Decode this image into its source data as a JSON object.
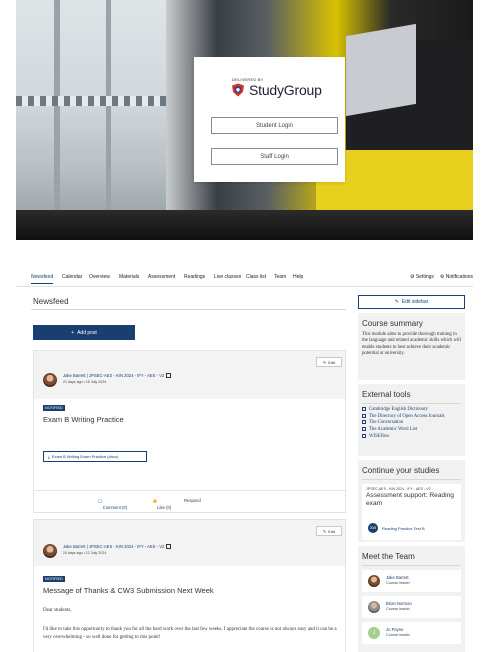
{
  "login": {
    "delivered_by": "DELIVERED BY",
    "brand": "StudyGroup",
    "student_login": "Student Login",
    "staff_login": "Staff Login"
  },
  "nav": {
    "tabs": [
      "Newsfeed",
      "Calendar",
      "Overview",
      "Materials",
      "Assessment",
      "Readings",
      "Live classes",
      "Class list",
      "Team",
      "Help"
    ],
    "settings": "Settings",
    "notifications": "Notifications"
  },
  "main": {
    "title": "Newsfeed",
    "add_post": "Add post",
    "posts": [
      {
        "edit": "Edit",
        "author": "Jake Barrett | JPSEC-AES - KIN 2024 - IFY - AES - V2",
        "meta": "21 days ago  •  15 July 2024",
        "badge": "NOTIFIED",
        "title": "Exam B Writing Practice",
        "attachment": "Exam B Writing Exam Practice (docx)",
        "comment": "Comment (0)",
        "like": "Like (0)",
        "respond": "Respond"
      },
      {
        "edit": "Edit",
        "author": "Jake Barrett | JPSEC-AES - KIN 2024 - IFY - AES - V2",
        "meta": "24 days ago  •  12 July 2024",
        "badge": "NOTIFIED",
        "title": "Message of Thanks & CW3 Submission Next Week",
        "greeting": "Dear students,",
        "body": "I'd like to take this opportunity to thank you for all the hard work over the last few weeks. I appreciate the course is not always easy and it can be a very overwhelming - so well done for getting to this point!"
      }
    ]
  },
  "sidebar": {
    "edit_sidebar": "Edit sidebar",
    "summary_title": "Course summary",
    "summary_text": "This module aims to provide thorough training in the language and related academic skills which will enable students to best achieve their academic potential at university.",
    "tools_title": "External tools",
    "tools": [
      "Cambridge English Dictionary",
      "The Directory of Open Access Journals",
      "The Conversation",
      "The Academic Word List",
      "WISEflow"
    ],
    "continue_title": "Continue your studies",
    "continue_code": "JPSEC-AES - KIN 2024 - IFY - AES - V2",
    "continue_card_title": "Assessment support: Reading exam",
    "test_badge": "20/8",
    "test_label": "Reading Practice Test B",
    "team_title": "Meet the Team",
    "team": [
      {
        "name": "Jake Barrett",
        "role": "Course leader"
      },
      {
        "name": "Brian Norman",
        "role": "Course leader"
      },
      {
        "name": "Jo Payne",
        "role": "Course leader"
      }
    ]
  },
  "colors": {
    "primary": "#1a3e6f",
    "accent_yellow": "#e7cf1d",
    "panel": "#f1f1f1"
  }
}
